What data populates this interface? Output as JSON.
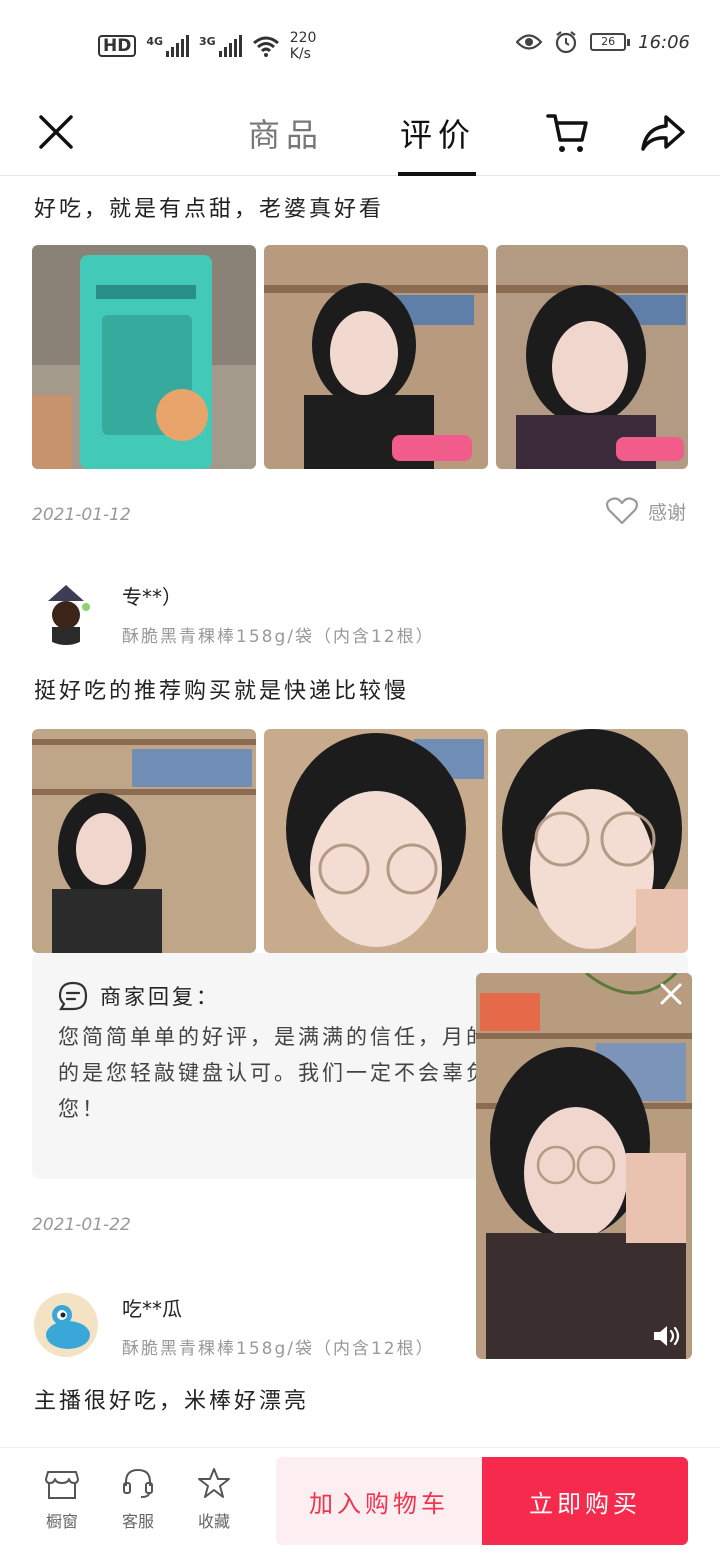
{
  "status_bar": {
    "hd": "HD",
    "sig1": "4G",
    "sig2": "3G",
    "speed_value": "220",
    "speed_unit": "K/s",
    "battery": "26",
    "time": "16:06"
  },
  "nav": {
    "tab_goods": "商品",
    "tab_review": "评价",
    "active_tab": "评价"
  },
  "reviews": [
    {
      "text": "好吃，就是有点甜，老婆真好看",
      "date": "2021-01-12",
      "thanks_label": "感谢"
    },
    {
      "user": "专**）",
      "spec": "酥脆黑青稞棒158g/袋（内含12根）",
      "text": "挺好吃的推荐购买就是快递比较慢",
      "merchant_reply_title": "商家回复：",
      "merchant_reply_body": "您简简单单的好评，是满满的信任，月的春风，德琴开心的是您轻敲键盘认可。我们一定不会辜负您的期望，报您！",
      "date": "2021-01-22"
    },
    {
      "user": "吃**瓜",
      "spec": "酥脆黑青稞棒158g/袋（内含12根）",
      "text": "主播很好吃，米棒好漂亮"
    }
  ],
  "bottom_bar": {
    "shop": "橱窗",
    "service": "客服",
    "favorite": "收藏",
    "add_cart": "加入购物车",
    "buy_now": "立即购买"
  },
  "colors": {
    "accent": "#f52a4d",
    "accent_light": "#fdeff1"
  }
}
